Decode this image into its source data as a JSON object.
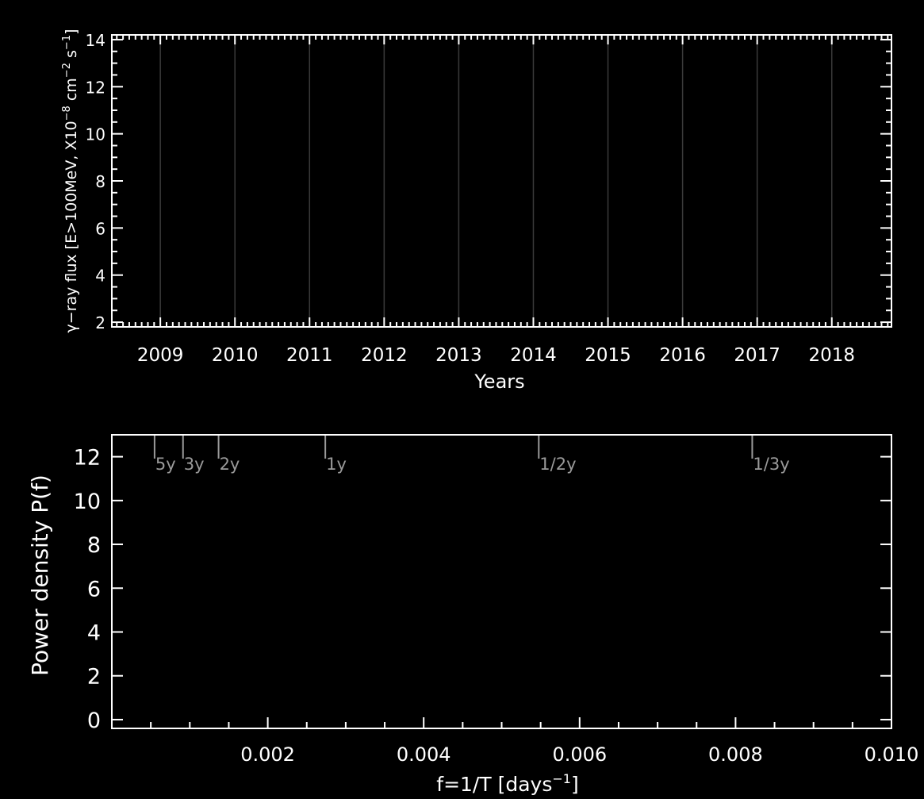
{
  "chart_data": [
    {
      "type": "line",
      "xlabel": "Years",
      "ylabel": "γ−ray flux [E>100MeV, X10",
      "ylabel_exp1": "−8",
      "ylabel_mid": " cm",
      "ylabel_exp2": "−2",
      "ylabel_mid2": " s",
      "ylabel_exp3": "−1",
      "ylabel_end": "]",
      "xlim": [
        2008.35,
        2018.8
      ],
      "ylim": [
        1.8,
        14.2
      ],
      "xticks": [
        "2009",
        "2010",
        "2011",
        "2012",
        "2013",
        "2014",
        "2015",
        "2016",
        "2017",
        "2018"
      ],
      "yticks": [
        "2",
        "4",
        "6",
        "8",
        "10",
        "12",
        "14"
      ],
      "year_lines": [
        2009,
        2010,
        2011,
        2012,
        2013,
        2014,
        2015,
        2016,
        2017,
        2018
      ],
      "series": []
    },
    {
      "type": "line",
      "xlabel": "f=1/T [days",
      "xlabel_exp": "−1",
      "xlabel_end": "]",
      "ylabel": "Power density P(f)",
      "xlim": [
        0,
        0.01
      ],
      "ylim": [
        -0.4,
        13
      ],
      "xticks": [
        "0.002",
        "0.004",
        "0.006",
        "0.008",
        "0.010"
      ],
      "yticks": [
        "0",
        "2",
        "4",
        "6",
        "8",
        "10",
        "12"
      ],
      "period_markers": [
        {
          "label": "5y",
          "f": 0.000548
        },
        {
          "label": "3y",
          "f": 0.000913
        },
        {
          "label": "2y",
          "f": 0.001369
        },
        {
          "label": "1y",
          "f": 0.002738
        },
        {
          "label": "1/2y",
          "f": 0.005476
        },
        {
          "label": "1/3y",
          "f": 0.008214
        }
      ],
      "series": []
    }
  ],
  "colors": {
    "background": "#000000",
    "axes": "#ffffff",
    "markers": "#9a9a9a",
    "year_lines": "#3a3a3a"
  }
}
